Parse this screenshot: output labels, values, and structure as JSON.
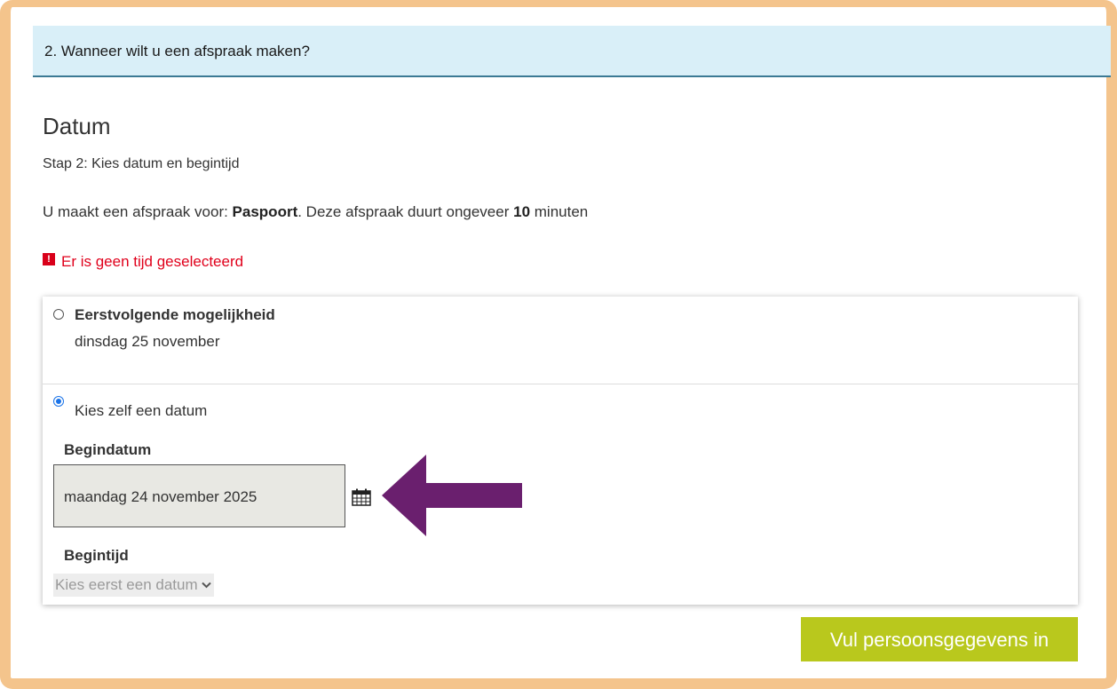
{
  "step_header": {
    "title": "2. Wanneer wilt u een afspraak maken?"
  },
  "section": {
    "heading": "Datum",
    "step_text": "Stap 2: Kies datum en begintijd",
    "intro_prefix": "U maakt een afspraak voor: ",
    "product": "Paspoort",
    "intro_middle": ". Deze afspraak duurt ongeveer ",
    "duration": "10",
    "intro_suffix": " minuten"
  },
  "error": {
    "icon": "exclamation-icon",
    "text": "Er is geen tijd geselecteerd",
    "color": "#e0001b"
  },
  "options": {
    "first_available": {
      "title": "Eerstvolgende mogelijkheid",
      "date": "dinsdag 25 november",
      "selected": false
    },
    "choose_date": {
      "label": "Kies zelf een datum",
      "selected": true
    }
  },
  "begindatum": {
    "label": "Begindatum",
    "value": "maandag 24 november 2025",
    "icon": "calendar-icon"
  },
  "begintijd": {
    "label": "Begintijd",
    "placeholder": "Kies eerst een datum",
    "icon": "chevron-down-icon"
  },
  "annotation": {
    "icon": "arrow-left-icon",
    "color": "#6a1f6e"
  },
  "submit": {
    "label": "Vul persoonsgegevens in",
    "color": "#b9c81d"
  },
  "colors": {
    "frame": "#f4c48c",
    "header_bg": "#d9eff8",
    "header_border": "#3b7a94"
  }
}
